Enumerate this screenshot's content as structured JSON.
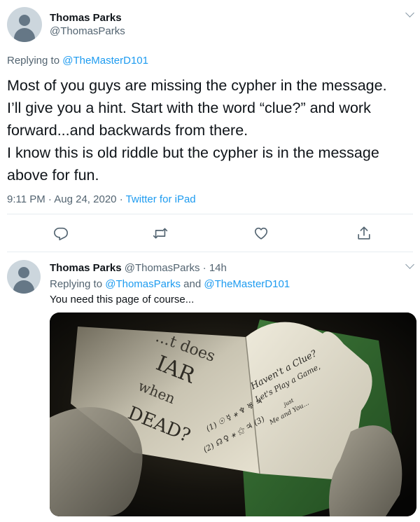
{
  "main_tweet": {
    "author_name": "Thomas Parks",
    "author_handle": "@ThomasParks",
    "replying_prefix": "Replying to",
    "replying_to": "@TheMasterD101",
    "text_lines": [
      "Most of you guys are missing the cypher in the message.",
      "I’ll give you a hint.  Start with the word “clue?” and work",
      "forward...and backwards from there.",
      "I know this is old riddle but the cypher is in the message",
      "above for fun."
    ],
    "time": "9:11 PM",
    "separator": "·",
    "date": "Aug 24, 2020",
    "source": "Twitter for iPad"
  },
  "actions": {
    "reply": "reply-icon",
    "retweet": "retweet-icon",
    "like": "heart-icon",
    "share": "share-icon"
  },
  "reply_tweet": {
    "author_name": "Thomas Parks",
    "author_handle": "@ThomasParks",
    "separator": "·",
    "time_ago": "14h",
    "replying_prefix": "Replying to",
    "replying_to_1": "@ThomasParks",
    "conjunction": "and",
    "replying_to_2": "@TheMasterD101",
    "text": "You need this page of course...",
    "media": {
      "card_left_text": [
        "...t does",
        "IAR",
        "when",
        "DEAD?"
      ],
      "card_right_text": [
        "Haven't a Clue?",
        "Let's Play a Game,",
        "just",
        "Me and You...",
        "(1) ☉ ☿ ⚹ ♆ ♅ ♃",
        "(2) ☊ ♀ ⚹ ⚝ ♃ (3)"
      ]
    }
  },
  "colors": {
    "accent": "#1d9bf0",
    "secondary_text": "#536471",
    "primary_text": "#0f1419",
    "divider": "#e6ecf0"
  }
}
